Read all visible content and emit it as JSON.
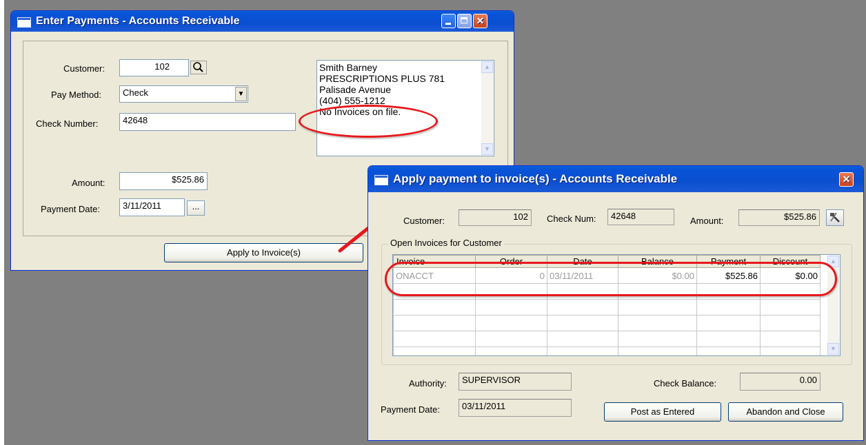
{
  "win1": {
    "title": "Enter Payments - Accounts Receivable",
    "customer_label": "Customer:",
    "customer_value": "102",
    "pay_method_label": "Pay Method:",
    "pay_method_value": "Check",
    "check_number_label": "Check Number:",
    "check_number_value": "42648",
    "amount_label": "Amount:",
    "amount_value": "$525.86",
    "payment_date_label": "Payment Date:",
    "payment_date_value": "3/11/2011",
    "date_picker_label": "...",
    "apply_button": "Apply to Invoice(s)",
    "info_lines": [
      "Smith Barney",
      "PRESCRIPTIONS PLUS 781",
      "Palisade Avenue",
      "(404) 555-1212",
      "No Invoices on file."
    ]
  },
  "win2": {
    "title": "Apply payment to invoice(s) - Accounts Receivable",
    "customer_label": "Customer:",
    "customer_value": "102",
    "check_num_label": "Check Num:",
    "check_num_value": "42648",
    "amount_label": "Amount:",
    "amount_value": "$525.86",
    "group_title": "Open Invoices for Customer",
    "columns": [
      "Invoice",
      "Order",
      "Date",
      "Balance",
      "Payment",
      "Discount"
    ],
    "rows": [
      [
        "ONACCT",
        "0",
        "03/11/2011",
        "$0.00",
        "$525.86",
        "$0.00"
      ]
    ],
    "authority_label": "Authority:",
    "authority_value": "SUPERVISOR",
    "check_balance_label": "Check Balance:",
    "check_balance_value": "0.00",
    "payment_date_label": "Payment Date:",
    "payment_date_value": "03/11/2011",
    "post_button": "Post as Entered",
    "abandon_button": "Abandon and Close"
  },
  "icons": [
    "window-icon",
    "minimize-icon",
    "maximize-icon",
    "close-icon",
    "search-icon",
    "dropdown-arrow-icon",
    "scroll-up-icon",
    "scroll-down-icon",
    "tool-icon"
  ],
  "colors": {
    "titlebar": "#0a4fd0",
    "window_bg": "#ece9d8",
    "callout": "#e8181c",
    "desktop": "#808080"
  }
}
